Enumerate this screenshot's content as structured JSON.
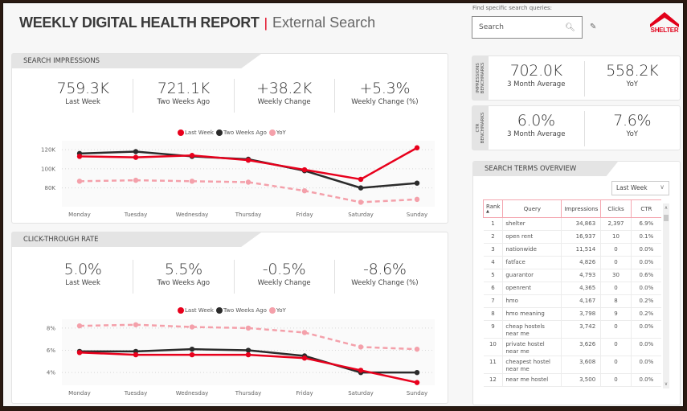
{
  "header": {
    "title_bold": "WEEKLY DIGITAL HEALTH REPORT",
    "separator": "|",
    "title_sub": "External Search"
  },
  "search": {
    "label": "Find specific search queries:",
    "placeholder": "Search",
    "search_icon": "magnifier-icon",
    "clear_icon": "eraser-icon"
  },
  "logo": {
    "text": "SHELTER",
    "color": "#e2001a"
  },
  "colors": {
    "last_week": "#e8001c",
    "two_weeks_ago": "#2b2b2b",
    "yoy": "#f4a0aa",
    "accent": "#e2001a"
  },
  "impressions": {
    "section_title": "SEARCH IMPRESSIONS",
    "kpis": [
      {
        "value": "759.3K",
        "label": "Last Week"
      },
      {
        "value": "721.1K",
        "label": "Two Weeks Ago"
      },
      {
        "value": "+38.2K",
        "label": "Weekly Change"
      },
      {
        "value": "+5.3%",
        "label": "Weekly Change (%)"
      }
    ]
  },
  "ctr": {
    "section_title": "CLICK-THROUGH RATE",
    "kpis": [
      {
        "value": "5.0%",
        "label": "Last Week"
      },
      {
        "value": "5.5%",
        "label": "Two Weeks Ago"
      },
      {
        "value": "-0.5%",
        "label": "Weekly Change"
      },
      {
        "value": "-8.6%",
        "label": "Weekly Change (%)"
      }
    ]
  },
  "legend": {
    "last_week": "Last Week",
    "two_weeks_ago": "Two Weeks Ago",
    "yoy": "YoY"
  },
  "chart_data": [
    {
      "type": "line",
      "title": "Search Impressions",
      "categories": [
        "Monday",
        "Tuesday",
        "Wednesday",
        "Thursday",
        "Friday",
        "Saturday",
        "Sunday"
      ],
      "yticks": [
        80000,
        100000,
        120000
      ],
      "ytick_labels": [
        "80K",
        "100K",
        "120K"
      ],
      "ylim": [
        62000,
        126000
      ],
      "grid": true,
      "legend_position": "top-center",
      "series": [
        {
          "name": "Last Week",
          "key": "last_week",
          "dashed": false,
          "values": [
            113000,
            112000,
            114000,
            109000,
            99000,
            89000,
            122000
          ]
        },
        {
          "name": "Two Weeks Ago",
          "key": "two_weeks_ago",
          "dashed": false,
          "values": [
            116000,
            118000,
            113000,
            110000,
            98000,
            80000,
            85000
          ]
        },
        {
          "name": "YoY",
          "key": "yoy",
          "dashed": true,
          "values": [
            87000,
            88000,
            87000,
            86000,
            77000,
            65000,
            68000
          ]
        }
      ]
    },
    {
      "type": "line",
      "title": "Click-Through Rate",
      "categories": [
        "Monday",
        "Tuesday",
        "Wednesday",
        "Thursday",
        "Friday",
        "Saturday",
        "Sunday"
      ],
      "yticks": [
        4,
        6,
        8
      ],
      "ytick_labels": [
        "4%",
        "6%",
        "8%"
      ],
      "ylim": [
        3.0,
        8.5
      ],
      "grid": true,
      "legend_position": "top-center",
      "series": [
        {
          "name": "Last Week",
          "key": "last_week",
          "dashed": false,
          "values": [
            5.8,
            5.6,
            5.6,
            5.6,
            5.3,
            4.2,
            3.1
          ]
        },
        {
          "name": "Two Weeks Ago",
          "key": "two_weeks_ago",
          "dashed": false,
          "values": [
            5.9,
            5.9,
            6.1,
            6.0,
            5.5,
            4.0,
            4.0
          ]
        },
        {
          "name": "YoY",
          "key": "yoy",
          "dashed": true,
          "values": [
            8.2,
            8.3,
            8.1,
            8.0,
            7.6,
            6.3,
            6.1
          ]
        }
      ]
    }
  ],
  "benchmarks": {
    "impressions": {
      "side_label": "IMPRESSIONS BENCHMARKS",
      "cells": [
        {
          "value": "702.0K",
          "label": "3 Month Average"
        },
        {
          "value": "558.2K",
          "label": "YoY"
        }
      ]
    },
    "ctr": {
      "side_label": "CTR BENCHMARKS",
      "cells": [
        {
          "value": "6.0%",
          "label": "3 Month Average"
        },
        {
          "value": "7.6%",
          "label": "YoY"
        }
      ]
    }
  },
  "search_terms": {
    "section_title": "SEARCH TERMS OVERVIEW",
    "period_selected": "Last Week",
    "columns": [
      "Rank",
      "Query",
      "Impressions",
      "Clicks",
      "CTR"
    ],
    "rows": [
      {
        "rank": "1",
        "query": "shelter",
        "impressions": "34,863",
        "clicks": "2,397",
        "ctr": "6.9%"
      },
      {
        "rank": "2",
        "query": "open rent",
        "impressions": "16,937",
        "clicks": "10",
        "ctr": "0.1%"
      },
      {
        "rank": "3",
        "query": "nationwide",
        "impressions": "11,514",
        "clicks": "0",
        "ctr": "0.0%"
      },
      {
        "rank": "4",
        "query": "fatface",
        "impressions": "4,826",
        "clicks": "0",
        "ctr": "0.0%"
      },
      {
        "rank": "5",
        "query": "guarantor",
        "impressions": "4,793",
        "clicks": "30",
        "ctr": "0.6%"
      },
      {
        "rank": "6",
        "query": "openrent",
        "impressions": "4,365",
        "clicks": "0",
        "ctr": "0.0%"
      },
      {
        "rank": "7",
        "query": "hmo",
        "impressions": "4,167",
        "clicks": "8",
        "ctr": "0.2%"
      },
      {
        "rank": "8",
        "query": "hmo meaning",
        "impressions": "3,798",
        "clicks": "9",
        "ctr": "0.2%"
      },
      {
        "rank": "9",
        "query": "cheap hostels near me",
        "impressions": "3,742",
        "clicks": "0",
        "ctr": "0.0%"
      },
      {
        "rank": "10",
        "query": "private hostel near me",
        "impressions": "3,626",
        "clicks": "0",
        "ctr": "0.0%"
      },
      {
        "rank": "11",
        "query": "cheapest hostel near me",
        "impressions": "3,608",
        "clicks": "0",
        "ctr": "0.0%"
      },
      {
        "rank": "12",
        "query": "near me hostel",
        "impressions": "3,500",
        "clicks": "0",
        "ctr": "0.0%"
      }
    ]
  }
}
